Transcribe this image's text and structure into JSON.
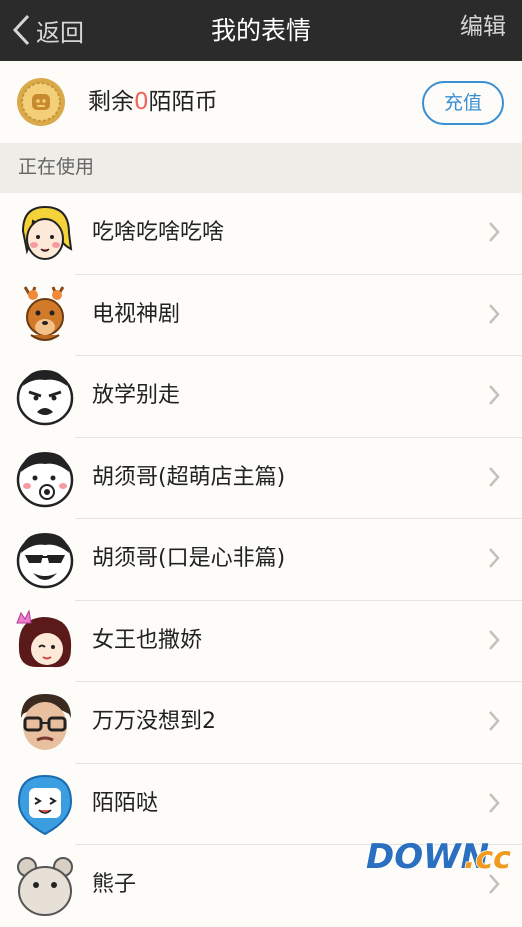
{
  "nav": {
    "back_label": "返回",
    "title": "我的表情",
    "edit_label": "编辑"
  },
  "balance": {
    "prefix": "剩余",
    "amount": "0",
    "suffix": "陌陌币",
    "recharge_label": "充值"
  },
  "section": {
    "in_use_label": "正在使用"
  },
  "stickers": [
    {
      "name": "吃啥吃啥吃啥",
      "icon": "blonde-girl-sticker-icon"
    },
    {
      "name": "电视神剧",
      "icon": "deer-sticker-icon"
    },
    {
      "name": "放学别走",
      "icon": "angry-face-sticker-icon"
    },
    {
      "name": "胡须哥(超萌店主篇)",
      "icon": "bearded-guy-sticker-icon"
    },
    {
      "name": "胡须哥(口是心非篇)",
      "icon": "sunglasses-guy-sticker-icon"
    },
    {
      "name": "女王也撒娇",
      "icon": "queen-sticker-icon"
    },
    {
      "name": "万万没想到2",
      "icon": "glasses-man-sticker-icon"
    },
    {
      "name": "陌陌哒",
      "icon": "momo-mascot-sticker-icon"
    },
    {
      "name": "熊子",
      "icon": "bear-sticker-icon"
    }
  ],
  "watermark": {
    "text": "DOWN.cc"
  },
  "colors": {
    "navbar": "#2b2b2b",
    "accent_blue": "#3a8fd2",
    "amount_red": "#f0645a",
    "background": "#f6f4ef"
  }
}
